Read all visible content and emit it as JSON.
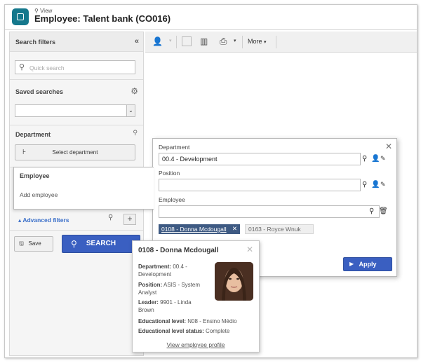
{
  "header": {
    "breadcrumb": "View",
    "title": "Employee: Talent bank (CO016)"
  },
  "filters": {
    "title": "Search filters",
    "quick_search_placeholder": "Quick search",
    "saved_searches": "Saved searches",
    "department": "Department",
    "select_department": "Select department",
    "advanced_filters": "Advanced filters",
    "save": "Save",
    "search": "SEARCH"
  },
  "toolbar": {
    "more": "More"
  },
  "employee_flyout": {
    "title": "Employee",
    "add": "Add employee"
  },
  "dialog": {
    "department_label": "Department",
    "department_value": "00.4 - Development",
    "position_label": "Position",
    "employee_label": "Employee",
    "chips": [
      "0108 - Donna Mcdougall",
      "0163 - Royce Wnuk"
    ],
    "apply": "Apply"
  },
  "profile": {
    "name": "0108 - Donna Mcdougall",
    "department_label": "Department:",
    "department": "00.4 - Development",
    "position_label": "Position:",
    "position": "ASIS - System Analyst",
    "leader_label": "Leader:",
    "leader": "9901 - Linda Brown",
    "edu_label": "Educational level:",
    "edu": "N08 - Ensino Médio",
    "edu_status_label": "Educational level status:",
    "edu_status": "Complete",
    "link": "View employee profile"
  },
  "colors": {
    "accent": "#3a5fc1",
    "chip": "#3e5a83",
    "app_icon": "#15788c"
  }
}
